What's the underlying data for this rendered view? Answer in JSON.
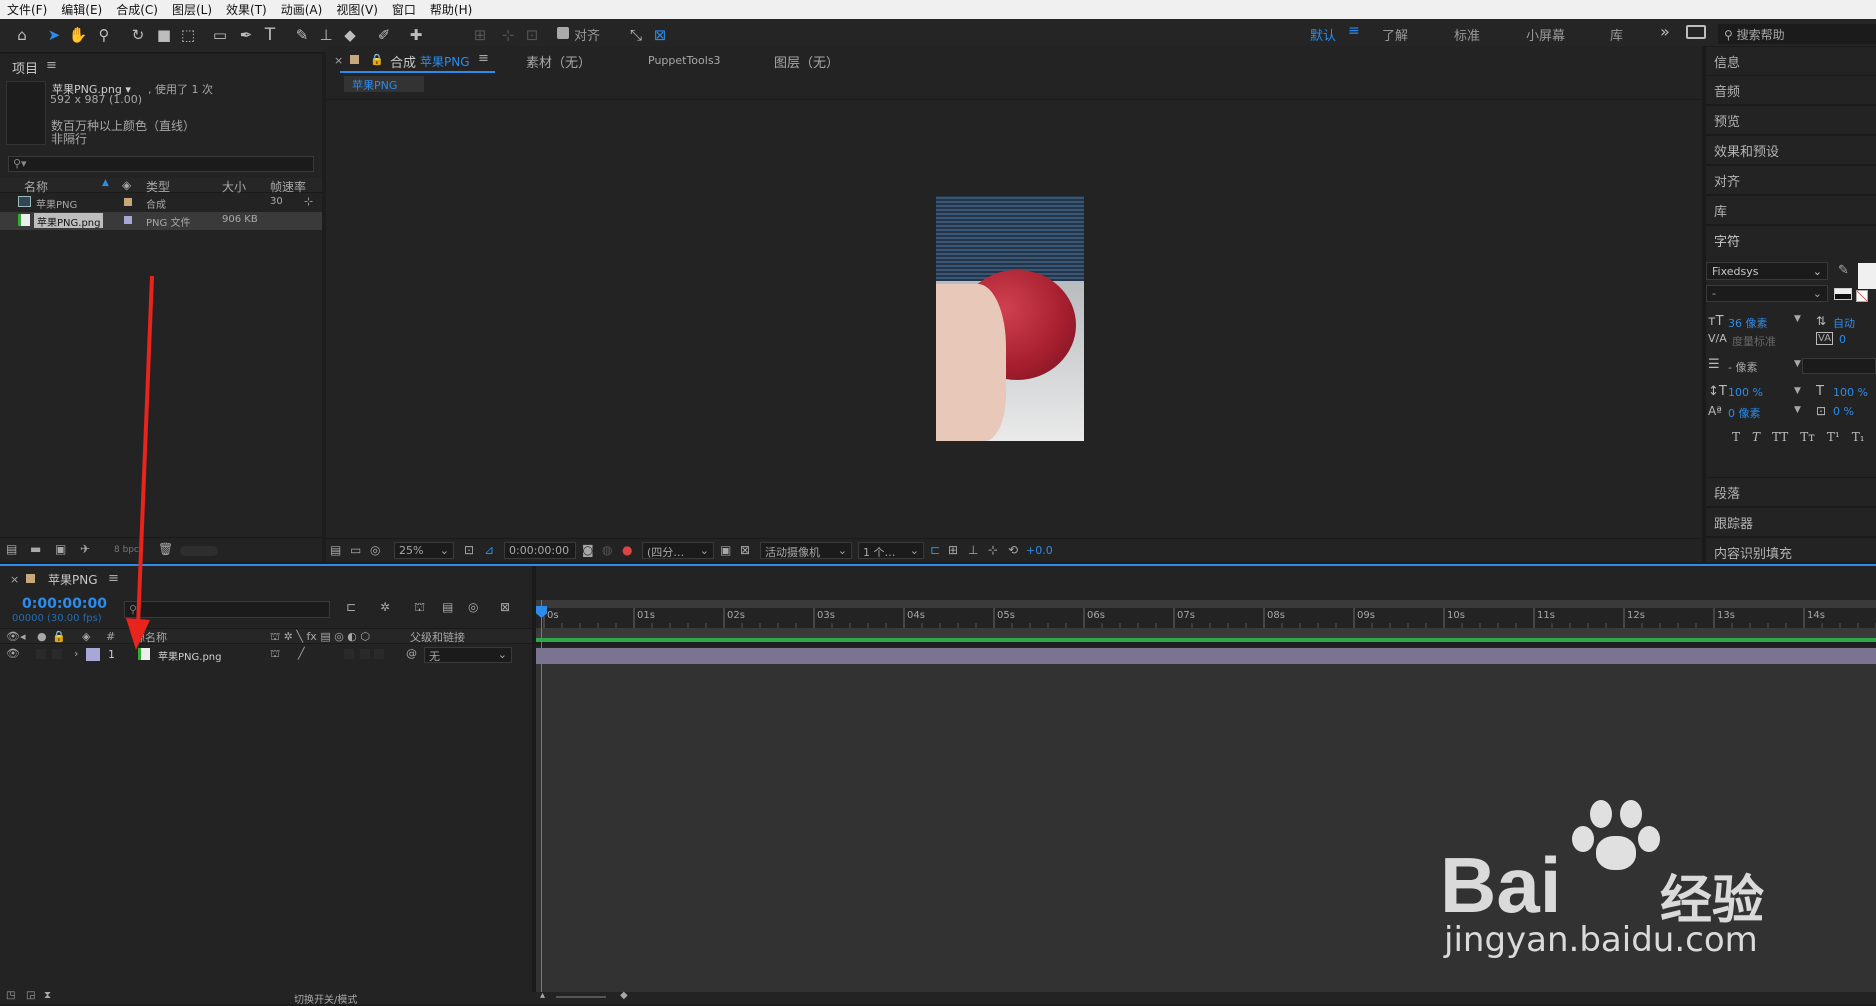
{
  "menu": [
    "文件(F)",
    "编辑(E)",
    "合成(C)",
    "图层(L)",
    "效果(T)",
    "动画(A)",
    "视图(V)",
    "窗口",
    "帮助(H)"
  ],
  "toolbar": {
    "snap_label": "对齐",
    "workspaces": [
      "默认",
      "了解",
      "标准",
      "小屏幕",
      "库"
    ],
    "search_placeholder": "搜索帮助"
  },
  "project": {
    "title": "项目",
    "file_name": "苹果PNG.png ▾",
    "used": ", 使用了 1 次",
    "dims": "592 x 987 (1.00)",
    "color_info": "数百万种以上颜色（直线）",
    "interlace": "非隔行",
    "columns": {
      "name": "名称",
      "type": "类型",
      "size": "大小",
      "fps": "帧速率"
    },
    "items": [
      {
        "name": "苹果PNG",
        "type": "合成",
        "size": "",
        "fps": "30"
      },
      {
        "name": "苹果PNG.png",
        "type": "PNG 文件",
        "size": "906 KB",
        "fps": ""
      }
    ],
    "bpc": "8 bpc"
  },
  "viewer": {
    "tabs": [
      "合成",
      "苹果PNG",
      "素材（无）",
      "PuppetTools3",
      "图层（无）"
    ],
    "sub_tab": "苹果PNG",
    "zoom": "25%",
    "timecode": "0:00:00:00",
    "resolution": "(四分…",
    "camera": "活动摄像机",
    "views": "1 个…",
    "exposure": "+0.0"
  },
  "right_panels": [
    "信息",
    "音频",
    "预览",
    "效果和预设",
    "对齐",
    "库",
    "字符"
  ],
  "character": {
    "font": "Fixedsys",
    "style": "-",
    "size": "36 像素",
    "leading": "自动",
    "kerning": "度量标准",
    "tracking": "0",
    "stroke": "- 像素",
    "vscale": "100 %",
    "hscale": "100 %",
    "baseline": "0 像素",
    "tsume": "0 %",
    "styles": [
      "T",
      "T",
      "TT",
      "Tт",
      "T¹",
      "T₁"
    ]
  },
  "right_bottom": [
    "段落",
    "跟踪器",
    "内容识别填充"
  ],
  "timeline": {
    "tab": "苹果PNG",
    "timecode": "0:00:00:00",
    "fps": "00000 (30.00 fps)",
    "col_name": "源名称",
    "col_parent": "父级和链接",
    "layer_num": "1",
    "layer_name": "苹果PNG.png",
    "parent_value": "无",
    "ticks": [
      "0s",
      "01s",
      "02s",
      "03s",
      "04s",
      "05s",
      "06s",
      "07s",
      "08s",
      "09s",
      "10s",
      "11s",
      "12s",
      "13s",
      "14s"
    ],
    "footer": "切换开关/模式"
  },
  "watermark": {
    "brand": "Bai",
    "brand2": "经验",
    "url": "jingyan.baidu.com"
  },
  "colors": {
    "accent": "#2d8ceb",
    "arrow": "#e8241c",
    "track": "#7a7490",
    "green": "#2fa84a"
  }
}
